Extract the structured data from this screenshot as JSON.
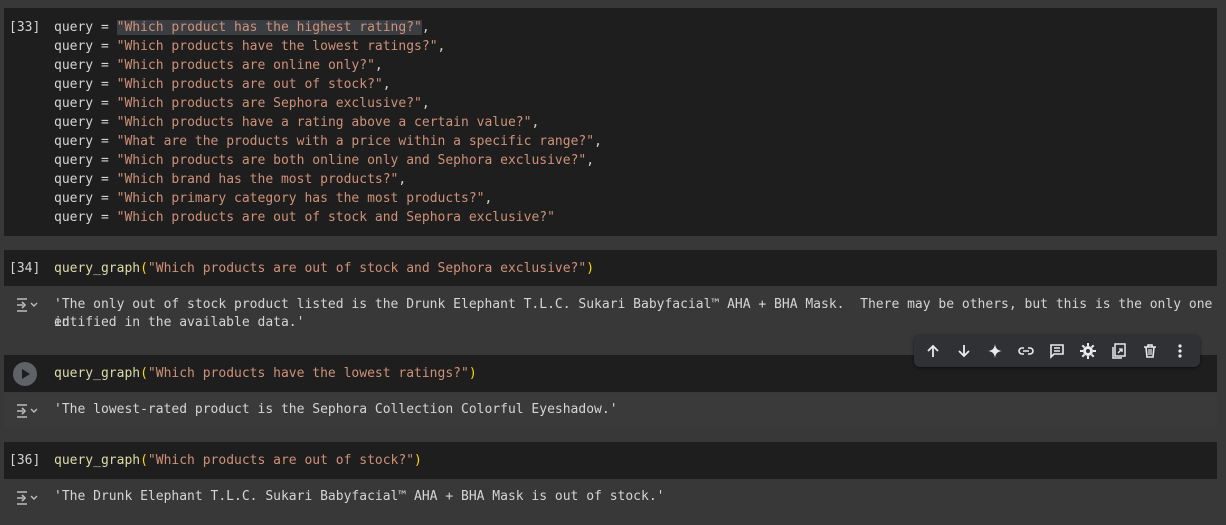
{
  "cell33": {
    "exec_count": "[33]",
    "var_name": "query",
    "op": " = ",
    "queries": [
      "\"Which product has the highest rating?\"",
      "\"Which products have the lowest ratings?\"",
      "\"Which products are online only?\"",
      "\"Which products are out of stock?\"",
      "\"Which products are Sephora exclusive?\"",
      "\"Which products have a rating above a certain value?\"",
      "\"What are the products with a price within a specific range?\"",
      "\"Which products are both online only and Sephora exclusive?\"",
      "\"Which brand has the most products?\"",
      "\"Which primary category has the most products?\"",
      "\"Which products are out of stock and Sephora exclusive?\""
    ],
    "trail_comma": ","
  },
  "cell34": {
    "exec_count": "[34]",
    "fn": "query_graph",
    "open_paren": "(",
    "arg": "\"Which products are out of stock and Sephora exclusive?\"",
    "close_paren": ")",
    "output_line1": "'The only out of stock product listed is the Drunk Elephant T.L.C. Sukari Babyfacial™ AHA + BHA Mask.  There may be others, but this is the only one id",
    "output_line2": "entified in the available data.'"
  },
  "cell35": {
    "fn": "query_graph",
    "open_paren": "(",
    "arg": "\"Which products have the lowest ratings?\"",
    "close_paren": ")",
    "output": "'The lowest-rated product is the Sephora Collection Colorful Eyeshadow.'"
  },
  "cell36": {
    "exec_count": "[36]",
    "fn": "query_graph",
    "open_paren": "(",
    "arg": "\"Which products are out of stock?\"",
    "close_paren": ")",
    "output": "'The Drunk Elephant T.L.C. Sukari Babyfacial™ AHA + BHA Mask is out of stock.'"
  },
  "toolbar": {
    "icons": [
      "arrow-up-icon",
      "arrow-down-icon",
      "sparkle-icon",
      "link-icon",
      "comment-icon",
      "gear-icon",
      "mirror-cell-icon",
      "delete-icon",
      "more-vert-icon"
    ]
  },
  "colors": {
    "background": "#383838",
    "cell_bg": "#1e1e1e",
    "string": "#ce9178",
    "function": "#dcdcaa",
    "paren": "#ffd700"
  }
}
